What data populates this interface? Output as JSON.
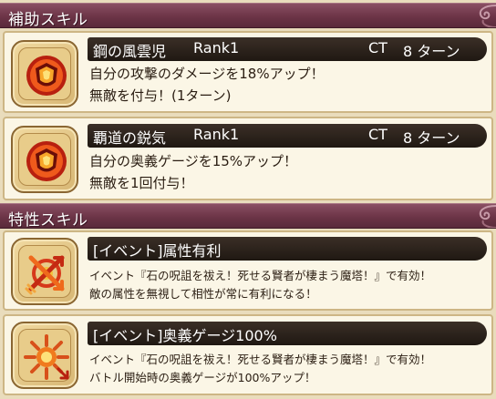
{
  "support_section": {
    "title": "補助スキル"
  },
  "trait_section": {
    "title": "特性スキル"
  },
  "support_skills": [
    {
      "name": "鋼の風雲児",
      "rank": "Rank1",
      "ct_label": "CT",
      "ct_value": "8 ターン",
      "line1": "自分の攻撃のダメージを18%アップ！",
      "line2": "無敵を付与！(1ターン)",
      "icon": "fire-shield-icon"
    },
    {
      "name": "覇道の鋭気",
      "rank": "Rank1",
      "ct_label": "CT",
      "ct_value": "8 ターン",
      "line1": "自分の奥義ゲージを15%アップ！",
      "line2": "無敵を1回付与！",
      "icon": "fire-shield-icon"
    }
  ],
  "trait_skills": [
    {
      "name": "[イベント]属性有利",
      "line1": "イベント『石の呪詛を祓え！死せる賢者が棲まう魔塔！』で有効！",
      "line2": "敵の属性を無視して相性が常に有利になる！",
      "icon": "crossed-arrows-icon"
    },
    {
      "name": "[イベント]奥義ゲージ100%",
      "line1": "イベント『石の呪詛を祓え！死せる賢者が棲まう魔塔！』で有効！",
      "line2": "バトル開始時の奥義ゲージが100%アップ！",
      "icon": "sunburst-arrow-icon"
    }
  ],
  "colors": {
    "header": "#6c3447",
    "bar": "#1f1812",
    "card": "#fbf6e6",
    "icon_fire": "#e8481c"
  }
}
